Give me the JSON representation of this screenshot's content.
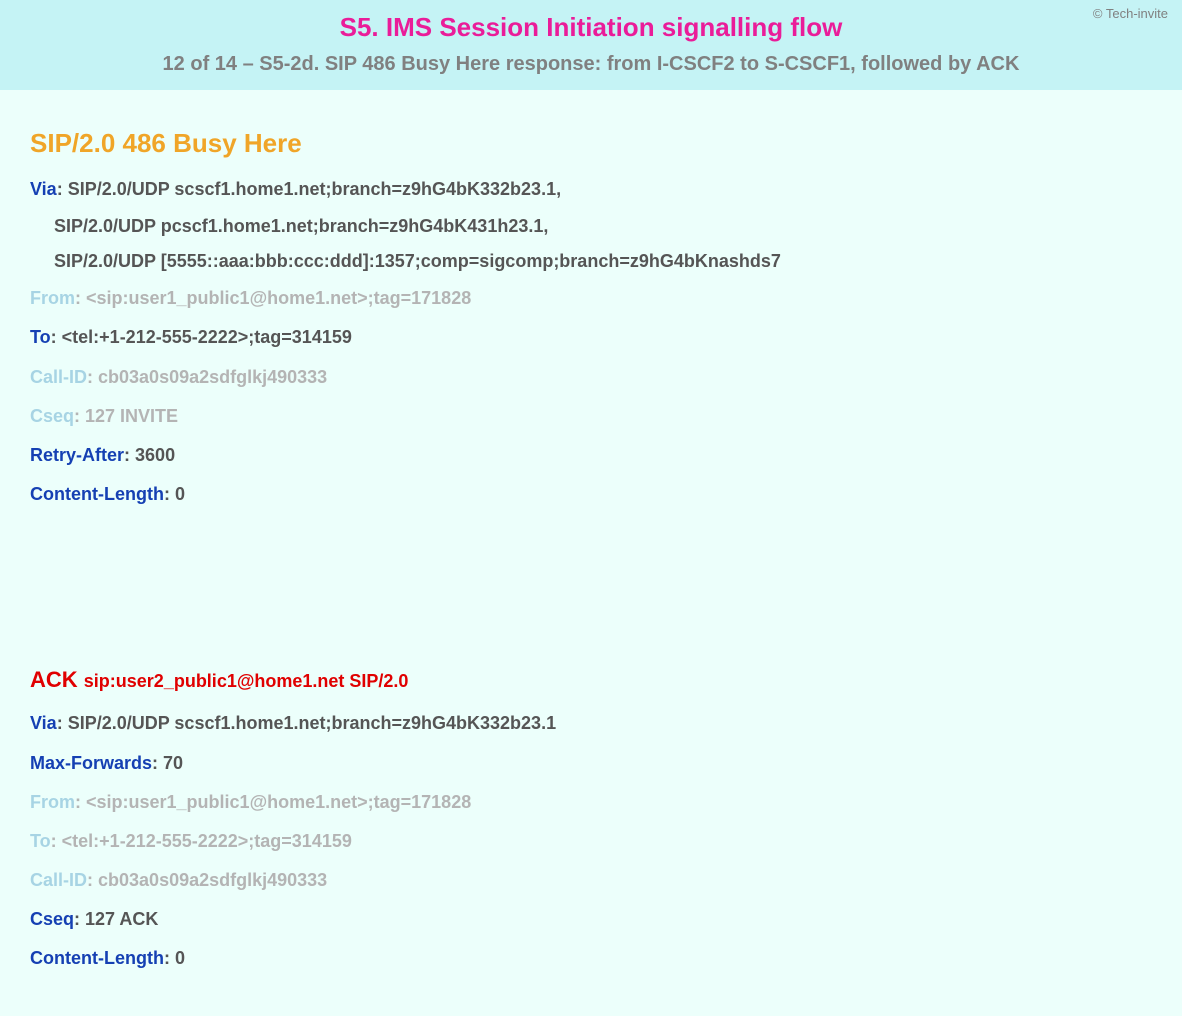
{
  "copyright": "© Tech-invite",
  "header": {
    "title": "S5. IMS Session Initiation signalling flow",
    "subtitle": "12 of 14 – S5-2d. SIP 486 Busy Here response: from I-CSCF2 to S-CSCF1, followed by ACK"
  },
  "response": {
    "status_line": "SIP/2.0 486 Busy Here",
    "via_label": "Via",
    "via_value": "SIP/2.0/UDP scscf1.home1.net;branch=z9hG4bK332b23.1,",
    "via_cont1": "SIP/2.0/UDP pcscf1.home1.net;branch=z9hG4bK431h23.1,",
    "via_cont2": "SIP/2.0/UDP [5555::aaa:bbb:ccc:ddd]:1357;comp=sigcomp;branch=z9hG4bKnashds7",
    "from_label": "From",
    "from_value": "<sip:user1_public1@home1.net>;tag=171828",
    "to_label": "To",
    "to_value": "<tel:+1-212-555-2222>;tag=314159",
    "callid_label": "Call-ID",
    "callid_value": "cb03a0s09a2sdfglkj490333",
    "cseq_label": "Cseq",
    "cseq_value": "127 INVITE",
    "retry_label": "Retry-After",
    "retry_value": "3600",
    "clen_label": "Content-Length",
    "clen_value": "0"
  },
  "ack": {
    "method": "ACK ",
    "uri": "sip:user2_public1@home1.net SIP/2.0",
    "via_label": "Via",
    "via_value": "SIP/2.0/UDP scscf1.home1.net;branch=z9hG4bK332b23.1",
    "maxf_label": "Max-Forwards",
    "maxf_value": "70",
    "from_label": "From",
    "from_value": "<sip:user1_public1@home1.net>;tag=171828",
    "to_label": "To",
    "to_value": "<tel:+1-212-555-2222>;tag=314159",
    "callid_label": "Call-ID",
    "callid_value": "cb03a0s09a2sdfglkj490333",
    "cseq_label": "Cseq",
    "cseq_value": "127 ACK",
    "clen_label": "Content-Length",
    "clen_value": "0"
  }
}
